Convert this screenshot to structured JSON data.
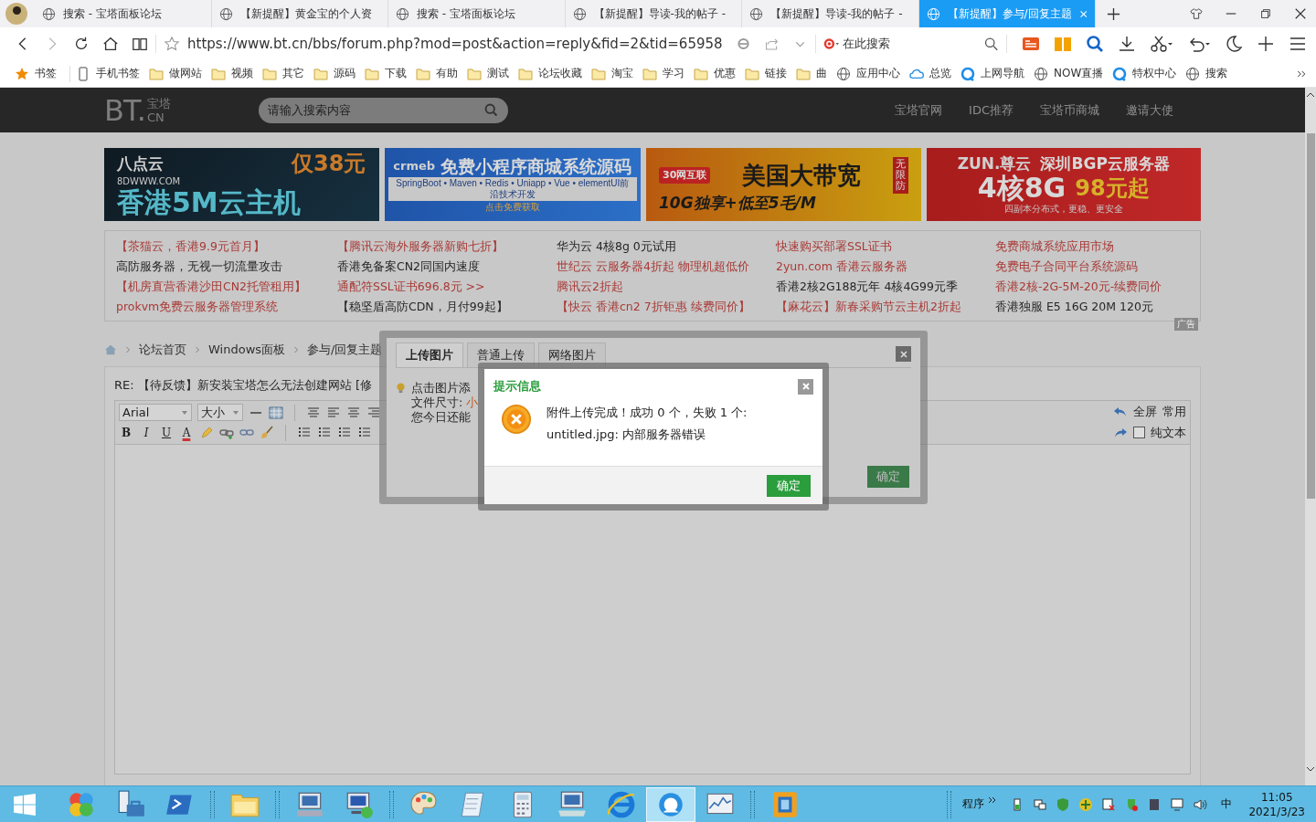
{
  "browser": {
    "tabs": [
      {
        "title": "搜索 - 宝塔面板论坛",
        "selected": false
      },
      {
        "title": "【新提醒】黄金宝的个人资",
        "selected": false
      },
      {
        "title": "搜索 - 宝塔面板论坛",
        "selected": false
      },
      {
        "title": "【新提醒】导读-我的帖子 -",
        "selected": false
      },
      {
        "title": "【新提醒】导读-我的帖子 -",
        "selected": false
      },
      {
        "title": "【新提醒】参与/回复主题",
        "selected": true
      }
    ],
    "url": "https://www.bt.cn/bbs/forum.php?mod=post&action=reply&fid=2&tid=65958",
    "search_placeholder": "在此搜索",
    "bookmarks": [
      {
        "label": "书签",
        "kind": "star"
      },
      {
        "label": "手机书签",
        "kind": "phone"
      },
      {
        "label": "做网站",
        "kind": "folder"
      },
      {
        "label": "视频",
        "kind": "folder"
      },
      {
        "label": "其它",
        "kind": "folder"
      },
      {
        "label": "源码",
        "kind": "folder"
      },
      {
        "label": "下载",
        "kind": "folder"
      },
      {
        "label": "有助",
        "kind": "folder"
      },
      {
        "label": "测试",
        "kind": "folder"
      },
      {
        "label": "论坛收藏",
        "kind": "folder"
      },
      {
        "label": "淘宝",
        "kind": "folder"
      },
      {
        "label": "学习",
        "kind": "folder"
      },
      {
        "label": "优惠",
        "kind": "folder"
      },
      {
        "label": "链接",
        "kind": "folder"
      },
      {
        "label": "曲",
        "kind": "folder"
      },
      {
        "label": "应用中心",
        "kind": "globe"
      },
      {
        "label": "总览",
        "kind": "cloud"
      },
      {
        "label": "上网导航",
        "kind": "q"
      },
      {
        "label": "NOW直播",
        "kind": "globe"
      },
      {
        "label": "特权中心",
        "kind": "q"
      },
      {
        "label": "搜索",
        "kind": "globe"
      }
    ]
  },
  "header": {
    "logo": {
      "main": "BT.",
      "top": "宝塔",
      "bottom": "CN"
    },
    "search_placeholder": "请输入搜索内容",
    "nav": [
      "宝塔官网",
      "IDC推荐",
      "宝塔币商城",
      "邀请大使"
    ]
  },
  "banners": [
    {
      "rows": [
        [
          {
            "text": "八点云",
            "kind": "brand"
          },
          {
            "text": "仅38元",
            "kind": "price"
          }
        ],
        [
          {
            "text": "8DWWW.COM",
            "kind": "small"
          }
        ],
        [
          {
            "text": "香港5M云主机",
            "kind": "headline"
          }
        ]
      ]
    },
    {
      "rows": [
        [
          {
            "text": "crmeb",
            "kind": "brand"
          },
          {
            "text": "免费小程序商城系统源码",
            "kind": "title"
          }
        ],
        [
          {
            "text": "SpringBoot • Maven • Redis • Uniapp • Vue • elementUI前沿技术开发",
            "kind": "strip"
          }
        ],
        [
          {
            "text": "点击免费获取",
            "kind": "small"
          }
        ]
      ]
    },
    {
      "rows": [
        [
          {
            "text": "30网互联",
            "kind": "brand"
          },
          {
            "text": "美国大带宽",
            "kind": "title"
          },
          {
            "text": "无限防",
            "kind": "tag"
          }
        ],
        [
          {
            "text": "10G独享+低至5毛/M",
            "kind": "sub"
          }
        ]
      ]
    },
    {
      "rows": [
        [
          {
            "text": "ZUN.尊云",
            "kind": "brand"
          },
          {
            "text": "深圳BGP云服务器",
            "kind": "sub"
          }
        ],
        [
          {
            "text": "4核8G",
            "kind": "headline"
          },
          {
            "text": "98元起",
            "kind": "price"
          }
        ],
        [
          {
            "text": "四副本分布式，更稳、更安全",
            "kind": "small"
          }
        ]
      ]
    }
  ],
  "text_ads": {
    "columns": [
      [
        {
          "text": "【茶猫云，香港9.9元首月】",
          "color": "#a83a36"
        },
        {
          "text": "高防服务器，无视一切流量攻击",
          "color": "#262626"
        },
        {
          "text": "【机房直营香港沙田CN2托管租用】",
          "color": "#a83a36"
        },
        {
          "text": "prokvm免费云服务器管理系统",
          "color": "#a83a36"
        }
      ],
      [
        {
          "text": "【腾讯云海外服务器新购七折】",
          "color": "#a83a36"
        },
        {
          "text": "香港免备案CN2同国内速度",
          "color": "#262626"
        },
        {
          "text": "通配符SSL证书696.8元 >>",
          "color": "#a83a36"
        },
        {
          "text": "【稳坚盾高防CDN，月付99起】",
          "color": "#262626"
        }
      ],
      [
        {
          "text": "华为云 4核8g 0元试用",
          "color": "#262626"
        },
        {
          "text": "世纪云 云服务器4折起 物理机超低价",
          "color": "#a83a36"
        },
        {
          "text": "腾讯云2折起",
          "color": "#a83a36"
        },
        {
          "text": "【快云 香港cn2 7折钜惠 续费同价】",
          "color": "#a83a36"
        }
      ],
      [
        {
          "text": "快速购买部署SSL证书",
          "color": "#a83a36"
        },
        {
          "text": "2yun.com 香港云服务器",
          "color": "#a83a36"
        },
        {
          "text": "香港2核2G188元年 4核4G99元季",
          "color": "#262626"
        },
        {
          "text": "【麻花云】新春采购节云主机2折起",
          "color": "#a83a36"
        }
      ],
      [
        {
          "text": "免费商城系统应用市场",
          "color": "#a83a36"
        },
        {
          "text": "免费电子合同平台系统源码",
          "color": "#a83a36"
        },
        {
          "text": "香港2核-2G-5M-20元-续费同价",
          "color": "#a83a36"
        },
        {
          "text": "香港独服 E5 16G 20M 120元",
          "color": "#262626"
        }
      ]
    ],
    "tag": "广告"
  },
  "breadcrumb": [
    "论坛首页",
    "Windows面板",
    "参与/回复主题"
  ],
  "editor": {
    "subject": "RE: 【待反馈】新安装宝塔怎么无法创建网站 [修",
    "font": "Arial",
    "size": "大小",
    "format_buttons": [
      "B",
      "I",
      "U",
      "A"
    ],
    "right_tools": [
      "全屏",
      "常用"
    ],
    "plain_text": {
      "label": "纯文本",
      "checked": false
    }
  },
  "upload_dialog": {
    "tabs": [
      {
        "label": "上传图片",
        "selected": true
      },
      {
        "label": "普通上传",
        "selected": false
      },
      {
        "label": "网络图片",
        "selected": false
      }
    ],
    "hints": [
      {
        "text": "点击图片添"
      },
      {
        "text": "文件尺寸: ",
        "accent": "小"
      },
      {
        "text": "您今日还能"
      }
    ],
    "confirm": "确定"
  },
  "alert": {
    "title": "提示信息",
    "lines": [
      "附件上传完成！成功 0 个，失败 1 个:",
      "untitled.jpg: 内部服务器错误"
    ],
    "confirm": "确定"
  },
  "taskbar": {
    "apps": [
      {
        "kind": "circles",
        "selected": false
      },
      {
        "kind": "server",
        "selected": false
      },
      {
        "kind": "terminal",
        "selected": false
      },
      {
        "kind": "folder",
        "selected": false
      },
      {
        "kind": "computer",
        "selected": false
      },
      {
        "kind": "remote",
        "selected": false
      },
      {
        "kind": "palette",
        "selected": false
      },
      {
        "kind": "notepad",
        "selected": false
      },
      {
        "kind": "calculator",
        "selected": false
      },
      {
        "kind": "keyboard",
        "selected": false
      },
      {
        "kind": "ie",
        "selected": false
      },
      {
        "kind": "browser",
        "selected": true
      },
      {
        "kind": "chart",
        "selected": false
      },
      {
        "kind": "box",
        "selected": false
      }
    ],
    "programs": "程序",
    "ime": "中",
    "time": "11:05",
    "date": "2021/3/23"
  }
}
